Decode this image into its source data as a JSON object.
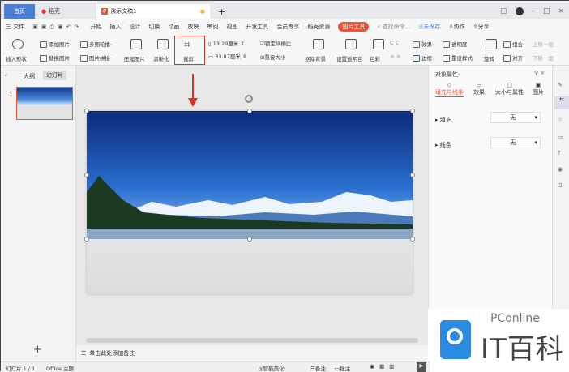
{
  "tabs": [
    {
      "label": "首页",
      "active": false
    },
    {
      "label": "稻壳"
    },
    {
      "label": "演示文稿1",
      "active": true
    }
  ],
  "menu": [
    "三 文件",
    "开始",
    "插入",
    "设计",
    "切换",
    "动画",
    "放映",
    "审阅",
    "视图",
    "开发工具",
    "会员专享",
    "稻壳资源"
  ],
  "menu_active": "图片工具",
  "search_placeholder": "查找命令...",
  "right_actions": [
    "未保存",
    "协作",
    "分享"
  ],
  "toolbar": {
    "insert_shape": "插入形状",
    "add_image": "添加图片",
    "replace_image": "替换图片",
    "multi_outline": "多图轮播",
    "image_stitch": "图片拼接",
    "compress": "压缩图片",
    "clarity": "清晰化",
    "crop": "裁剪",
    "height": "13.29厘米",
    "width": "33.87厘米",
    "lock_ratio": "锁定纵横比",
    "reset_size": "重设大小",
    "remove_bg": "抠除背景",
    "set_transparent": "设置透明色",
    "color": "色彩",
    "effect": "效果",
    "transparency": "透明度",
    "border": "边框",
    "reset_style": "重设样式",
    "rotate": "旋转",
    "group": "组合",
    "align": "对齐",
    "bring_forward": "上移一层",
    "send_backward": "下移一层"
  },
  "left_panel": {
    "tabs": [
      "大纲",
      "幻灯片"
    ],
    "slide_number": "1"
  },
  "right_panel": {
    "title": "对象属性",
    "tabs": [
      "填充与线条",
      "效果",
      "大小与属性",
      "图片"
    ],
    "fill_label": "填充",
    "fill_value": "无",
    "line_label": "线条",
    "line_value": "无"
  },
  "notes_placeholder": "单击此处添加备注",
  "status": {
    "slide": "幻灯片 1 / 1",
    "theme": "Office 主题",
    "beautify": "智能美化",
    "notes": "备注",
    "comments": "批注"
  },
  "watermark": {
    "text": "PConline",
    "brand": "IT百科"
  },
  "colors": {
    "accent": "#e4573a",
    "home_tab": "#4a7fd8",
    "highlight": "#d9342b"
  }
}
